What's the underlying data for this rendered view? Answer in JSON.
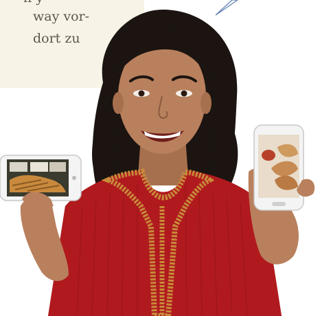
{
  "info_box": {
    "lines": [
      "n y",
      "way vor-",
      "dort zu"
    ],
    "background": "#f7f3e6",
    "text_color": "#5e564c"
  },
  "photo": {
    "background": "#ffffff",
    "kurta_color": "#b01a1e",
    "embroidery_color": "#c88a3a",
    "hair_color": "#1b1411",
    "skin_color": "#b9805d"
  },
  "icons": {
    "left_phone": "smartphone-icon",
    "right_phone": "smartphone-icon",
    "speech_pointer": "speech-bubble-pointer-icon"
  }
}
